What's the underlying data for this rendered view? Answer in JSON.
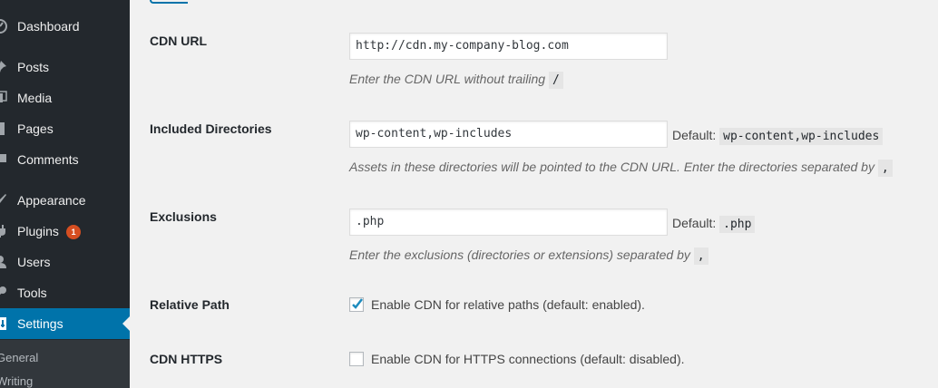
{
  "sidebar": {
    "items": [
      {
        "label": "Dashboard",
        "icon": "dashboard-icon"
      },
      {
        "label": "Posts",
        "icon": "pushpin-icon"
      },
      {
        "label": "Media",
        "icon": "media-icon"
      },
      {
        "label": "Pages",
        "icon": "page-icon"
      },
      {
        "label": "Comments",
        "icon": "comment-icon"
      },
      {
        "label": "Appearance",
        "icon": "paintbrush-icon"
      },
      {
        "label": "Plugins",
        "icon": "plugin-icon",
        "badge": "1"
      },
      {
        "label": "Users",
        "icon": "user-icon"
      },
      {
        "label": "Tools",
        "icon": "wrench-icon"
      },
      {
        "label": "Settings",
        "icon": "settings-icon",
        "current": true
      }
    ],
    "submenu": [
      {
        "label": "General"
      },
      {
        "label": "Writing"
      }
    ]
  },
  "form": {
    "cdn_url": {
      "label": "CDN URL",
      "value": "http://cdn.my-company-blog.com",
      "description": "Enter the CDN URL without trailing",
      "description_code": "/"
    },
    "included_dirs": {
      "label": "Included Directories",
      "value": "wp-content,wp-includes",
      "default_label": "Default:",
      "default_value": "wp-content,wp-includes",
      "description": "Assets in these directories will be pointed to the CDN URL. Enter the directories separated by",
      "description_code": ","
    },
    "exclusions": {
      "label": "Exclusions",
      "value": ".php",
      "default_label": "Default:",
      "default_value": ".php",
      "description": "Enter the exclusions (directories or extensions) separated by",
      "description_code": ","
    },
    "relative_path": {
      "label": "Relative Path",
      "checkbox_label": "Enable CDN for relative paths (default: enabled).",
      "checked": true
    },
    "cdn_https": {
      "label": "CDN HTTPS",
      "checkbox_label": "Enable CDN for HTTPS connections (default: disabled).",
      "checked": false
    }
  },
  "colors": {
    "sidebar_bg": "#23282d",
    "accent": "#0073aa",
    "badge": "#d54e21"
  }
}
